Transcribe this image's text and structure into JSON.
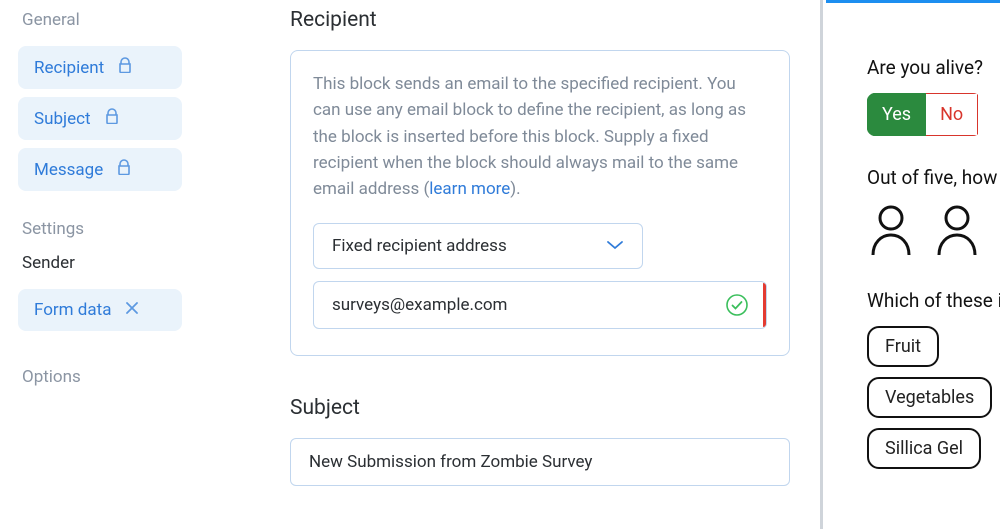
{
  "sidebar": {
    "heading_general": "General",
    "items": [
      {
        "label": "Recipient",
        "icon": "lock"
      },
      {
        "label": "Subject",
        "icon": "lock"
      },
      {
        "label": "Message",
        "icon": "lock"
      }
    ],
    "heading_settings": "Settings",
    "sender_label": "Sender",
    "form_data_label": "Form data",
    "heading_options": "Options"
  },
  "main": {
    "recipient": {
      "title": "Recipient",
      "description_pre": "This block sends an email to the specified recipient. You can use any email block to define the recipient, as long as the block is inserted before this block. Supply a fixed recipient when the block should always mail to the same email address (",
      "learn_more": "learn more",
      "description_post": ").",
      "select_label": "Fixed recipient address",
      "email_value": "surveys@example.com"
    },
    "subject": {
      "title": "Subject",
      "value": "New Submission from Zombie Survey"
    }
  },
  "preview": {
    "q1": "Are you alive?",
    "yes": "Yes",
    "no": "No",
    "q2": "Out of five, how e",
    "q3": "Which of these ite",
    "chips": [
      "Fruit",
      "Vegetables",
      "Sillica Gel"
    ]
  }
}
